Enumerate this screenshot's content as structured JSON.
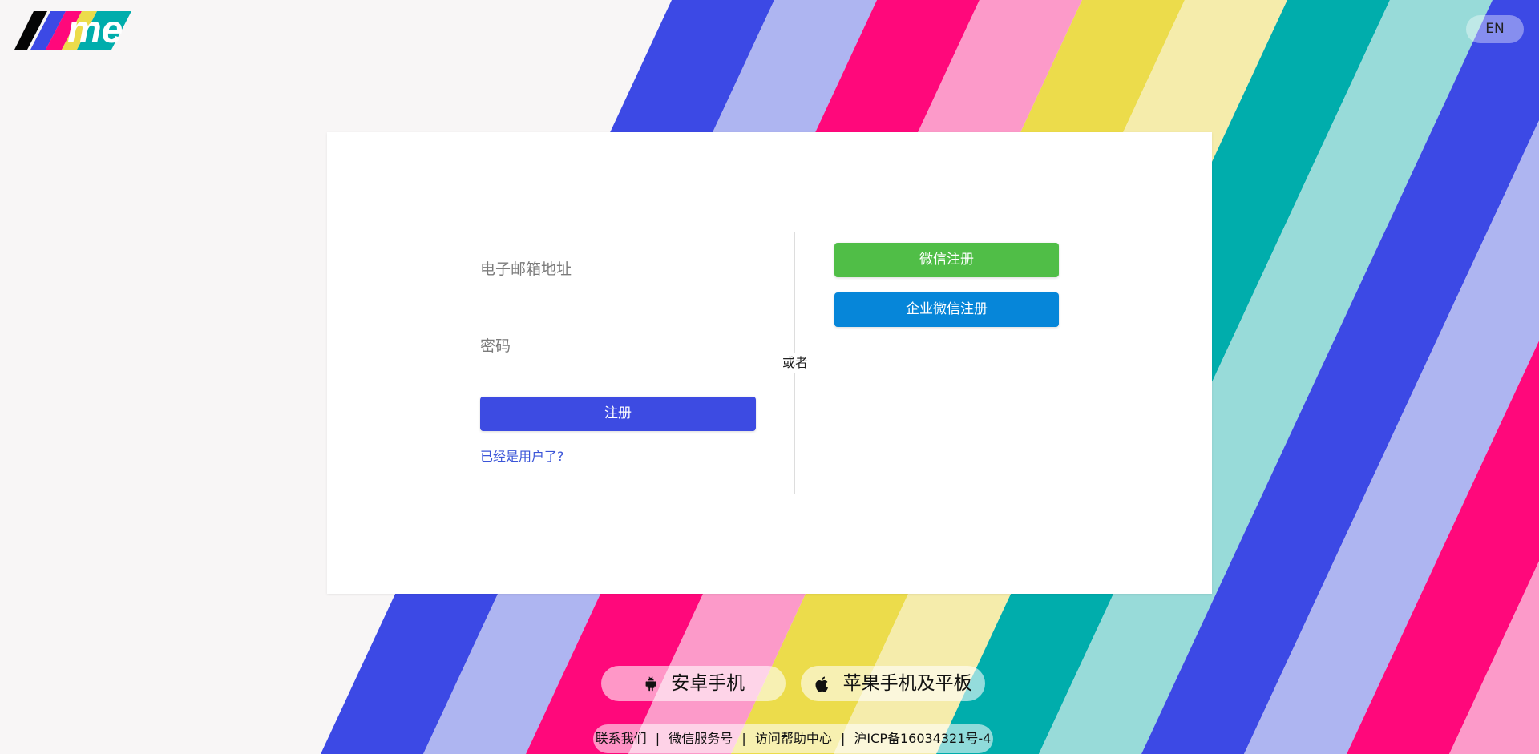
{
  "brand": {
    "logo_text": "me",
    "colors": {
      "blue": "#3c49e5",
      "light_blue": "#aeb5f1",
      "magenta": "#ff087b",
      "pink": "#fc9ac9",
      "yellow": "#ecdc4b",
      "light_yellow": "#f5ecab",
      "teal": "#00adac",
      "light_teal": "#98dbd9",
      "background": "#f8f6f6"
    }
  },
  "header": {
    "language_button": "EN"
  },
  "form": {
    "email_placeholder": "电子邮箱地址",
    "password_placeholder": "密码",
    "register_button": "注册",
    "existing_user_link": "已经是用户了?",
    "divider_text": "或者",
    "wechat_register_button": "微信注册",
    "enterprise_wechat_register_button": "企业微信注册"
  },
  "apps": {
    "android": "安卓手机",
    "apple": "苹果手机及平板"
  },
  "footer": {
    "contact": "联系我们",
    "wechat_service": "微信服务号",
    "help_center": "访问帮助中心",
    "icp": "沪ICP备16034321号-4",
    "separator": "|"
  }
}
